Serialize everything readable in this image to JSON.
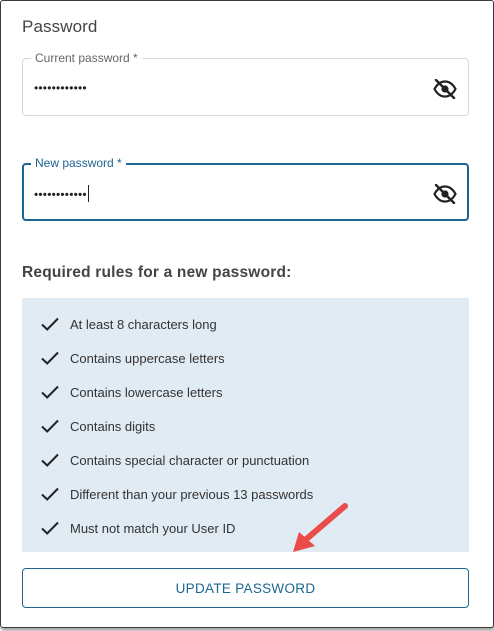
{
  "form": {
    "section_title": "Password",
    "current_password": {
      "label": "Current password *",
      "value": "••••••••••••",
      "toggle_icon": "eye-off-icon"
    },
    "new_password": {
      "label": "New password *",
      "value": "••••••••••••",
      "toggle_icon": "eye-off-icon"
    }
  },
  "rules": {
    "title": "Required rules for a new password:",
    "items": [
      {
        "label": "At least 8 characters long",
        "icon": "check-icon"
      },
      {
        "label": "Contains uppercase letters",
        "icon": "check-icon"
      },
      {
        "label": "Contains lowercase letters",
        "icon": "check-icon"
      },
      {
        "label": "Contains digits",
        "icon": "check-icon"
      },
      {
        "label": "Contains special character or punctuation",
        "icon": "check-icon"
      },
      {
        "label": "Different than your previous 13 passwords",
        "icon": "check-icon"
      },
      {
        "label": "Must not match your User ID",
        "icon": "check-icon"
      }
    ]
  },
  "actions": {
    "update_label": "UPDATE PASSWORD"
  },
  "colors": {
    "accent": "#1c6591",
    "rules_background": "#e1ebf3",
    "annotation_arrow": "#ea4b4b"
  }
}
